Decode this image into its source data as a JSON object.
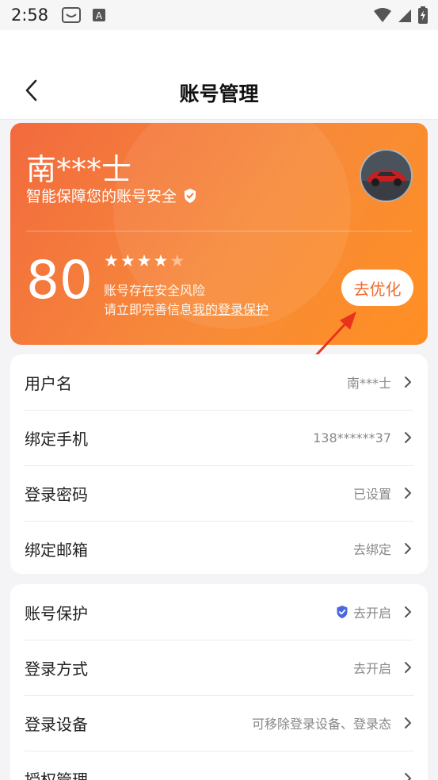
{
  "status_bar": {
    "time": "2:58"
  },
  "nav": {
    "title": "账号管理"
  },
  "profile": {
    "name": "南***士",
    "slogan": "智能保障您的账号安全",
    "score": "80",
    "rating": 4,
    "rating_max": 5,
    "risk_line1": "账号存在安全风险",
    "risk_line2_prefix": "请立即完善信息",
    "risk_link": "我的登录保护",
    "optimize_label": "去优化"
  },
  "account_rows": [
    {
      "label": "用户名",
      "value": "南***士"
    },
    {
      "label": "绑定手机",
      "value": "138******37"
    },
    {
      "label": "登录密码",
      "value": "已设置"
    },
    {
      "label": "绑定邮箱",
      "value": "去绑定"
    }
  ],
  "security_rows": [
    {
      "label": "账号保护",
      "value": "去开启"
    },
    {
      "label": "登录方式",
      "value": "去开启"
    },
    {
      "label": "登录设备",
      "value": "可移除登录设备、登录态"
    },
    {
      "label": "授权管理",
      "value": ""
    }
  ],
  "colors": {
    "accent": "#f26a2a",
    "hero_start": "#f26a3e",
    "hero_end": "#ff8f22",
    "shield_blue": "#4a67e0",
    "arrow_red": "#e8341c"
  }
}
